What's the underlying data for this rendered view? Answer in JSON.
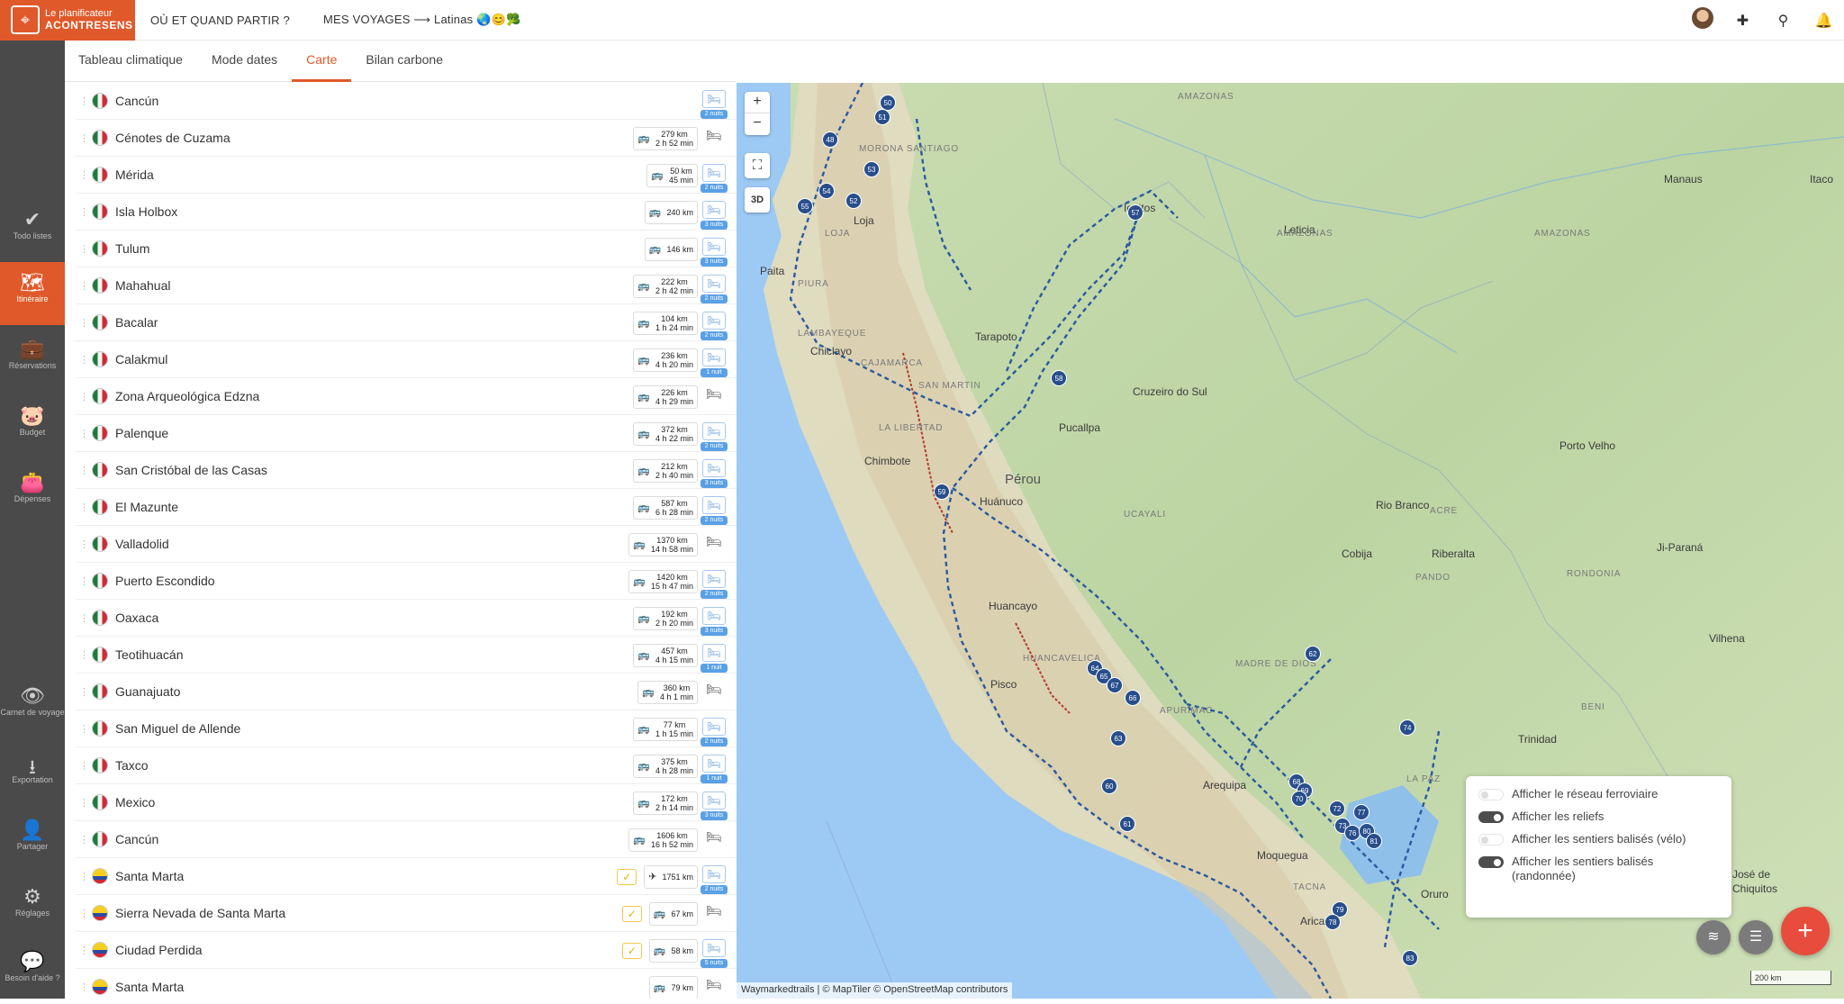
{
  "app": {
    "logo_line1": "Le planificateur",
    "logo_line2": "ACONTRESENS",
    "nav_where": "OÙ ET QUAND PARTIR ?",
    "nav_trips": "MES VOYAGES ⟶ Latinas 🌏😊🥦"
  },
  "sidebar": {
    "items": [
      {
        "label": "Todo listes",
        "icon": "check-icon"
      },
      {
        "label": "Itinéraire",
        "icon": "map-icon"
      },
      {
        "label": "Réservations",
        "icon": "suitcase-icon"
      },
      {
        "label": "Budget",
        "icon": "piggy-bank-icon"
      },
      {
        "label": "Dépenses",
        "icon": "wallet-icon"
      },
      {
        "label": "Carnet de voyage",
        "icon": "eye-icon"
      },
      {
        "label": "Exportation",
        "icon": "download-icon"
      },
      {
        "label": "Partager",
        "icon": "add-user-icon"
      },
      {
        "label": "Réglages",
        "icon": "gear-icon"
      },
      {
        "label": "Besoin d'aide ?",
        "icon": "chat-icon"
      }
    ]
  },
  "tabs": [
    "Tableau climatique",
    "Mode dates",
    "Carte",
    "Bilan carbone"
  ],
  "active_tab": "Carte",
  "itinerary": [
    {
      "name": "Cancún",
      "flag": "mx",
      "dist": "",
      "time": "",
      "nights": "2 nuits",
      "num": "1",
      "color": "yellow",
      "mode": ""
    },
    {
      "name": "Cénotes de Cuzama",
      "flag": "mx",
      "dist": "279 km",
      "time": "2 h 52 min",
      "nights": "",
      "num": "2",
      "color": "green",
      "mode": "bus"
    },
    {
      "name": "Mérida",
      "flag": "mx",
      "dist": "50 km",
      "time": "45 min",
      "nights": "2 nuits",
      "num": "3",
      "color": "green",
      "mode": "bus"
    },
    {
      "name": "Isla Holbox",
      "flag": "mx",
      "dist": "240 km",
      "time": "",
      "nights": "3 nuits",
      "num": "4",
      "color": "green",
      "mode": "bus"
    },
    {
      "name": "Tulum",
      "flag": "mx",
      "dist": "146 km",
      "time": "",
      "nights": "3 nuits",
      "num": "5",
      "color": "green",
      "mode": "bus"
    },
    {
      "name": "Mahahual",
      "flag": "mx",
      "dist": "222 km",
      "time": "2 h 42 min",
      "nights": "2 nuits",
      "num": "6",
      "color": "green",
      "mode": "bus"
    },
    {
      "name": "Bacalar",
      "flag": "mx",
      "dist": "104 km",
      "time": "1 h 24 min",
      "nights": "2 nuits",
      "num": "7",
      "color": "green",
      "mode": "bus"
    },
    {
      "name": "Calakmul",
      "flag": "mx",
      "dist": "236 km",
      "time": "4 h 20 min",
      "nights": "1 nuit",
      "num": "8",
      "color": "green",
      "mode": "bus"
    },
    {
      "name": "Zona Arqueológica Edzna",
      "flag": "mx",
      "dist": "226 km",
      "time": "4 h 29 min",
      "nights": "",
      "num": "9",
      "color": "green",
      "mode": "bus"
    },
    {
      "name": "Palenque",
      "flag": "mx",
      "dist": "372 km",
      "time": "4 h 22 min",
      "nights": "2 nuits",
      "num": "10",
      "color": "green",
      "mode": "bus"
    },
    {
      "name": "San Cristóbal de las Casas",
      "flag": "mx",
      "dist": "212 km",
      "time": "2 h 40 min",
      "nights": "3 nuits",
      "num": "11",
      "color": "yellow",
      "mode": "bus"
    },
    {
      "name": "El Mazunte",
      "flag": "mx",
      "dist": "587 km",
      "time": "6 h 28 min",
      "nights": "2 nuits",
      "num": "12",
      "color": "green",
      "mode": "bus"
    },
    {
      "name": "Valladolid",
      "flag": "mx",
      "dist": "1370 km",
      "time": "14 h 58 min",
      "nights": "",
      "num": "13",
      "color": "green",
      "mode": "bus"
    },
    {
      "name": "Puerto Escondido",
      "flag": "mx",
      "dist": "1420 km",
      "time": "15 h 47 min",
      "nights": "2 nuits",
      "num": "14",
      "color": "green",
      "mode": "bus"
    },
    {
      "name": "Oaxaca",
      "flag": "mx",
      "dist": "192 km",
      "time": "2 h 20 min",
      "nights": "3 nuits",
      "num": "15",
      "color": "green",
      "mode": "bus"
    },
    {
      "name": "Teotihuacán",
      "flag": "mx",
      "dist": "457 km",
      "time": "4 h 15 min",
      "nights": "1 nuit",
      "num": "16",
      "color": "red",
      "mode": "bus"
    },
    {
      "name": "Guanajuato",
      "flag": "mx",
      "dist": "360 km",
      "time": "4 h 1 min",
      "nights": "",
      "num": "17",
      "color": "orange",
      "mode": "bus"
    },
    {
      "name": "San Miguel de Allende",
      "flag": "mx",
      "dist": "77 km",
      "time": "1 h 15 min",
      "nights": "2 nuits",
      "num": "18",
      "color": "orange",
      "mode": "bus"
    },
    {
      "name": "Taxco",
      "flag": "mx",
      "dist": "375 km",
      "time": "4 h 28 min",
      "nights": "1 nuit",
      "num": "19",
      "color": "green",
      "mode": "bus"
    },
    {
      "name": "Mexico",
      "flag": "mx",
      "dist": "172 km",
      "time": "2 h 14 min",
      "nights": "3 nuits",
      "num": "20",
      "color": "yellow",
      "mode": "bus"
    },
    {
      "name": "Cancún",
      "flag": "mx",
      "dist": "1606 km",
      "time": "16 h 52 min",
      "nights": "",
      "num": "21",
      "color": "yellow",
      "mode": "bus"
    },
    {
      "name": "Santa Marta",
      "flag": "co",
      "dist": "1751 km",
      "time": "",
      "nights": "2 nuits",
      "num": "22",
      "color": "green",
      "mode": "plane",
      "check": true
    },
    {
      "name": "Sierra Nevada de Santa Marta",
      "flag": "co",
      "dist": "67 km",
      "time": "",
      "nights": "",
      "num": "23",
      "color": "green",
      "mode": "bus",
      "check": true
    },
    {
      "name": "Ciudad Perdida",
      "flag": "co",
      "dist": "58 km",
      "time": "",
      "nights": "5 nuits",
      "num": "24",
      "color": "green",
      "mode": "bus",
      "check": true
    },
    {
      "name": "Santa Marta",
      "flag": "co",
      "dist": "79 km",
      "time": "",
      "nights": "",
      "num": "25",
      "color": "yellow",
      "mode": "bus"
    }
  ],
  "map": {
    "labels": [
      {
        "text": "Manaus",
        "cls": ""
      },
      {
        "text": "Itaco",
        "cls": ""
      },
      {
        "text": "AMAZONAS",
        "cls": "small"
      },
      {
        "text": "AMAZONAS",
        "cls": "small"
      },
      {
        "text": "Leticia",
        "cls": ""
      },
      {
        "text": "Iquitos",
        "cls": ""
      },
      {
        "text": "Paita",
        "cls": ""
      },
      {
        "text": "Loja",
        "cls": ""
      },
      {
        "text": "Chiclayo",
        "cls": ""
      },
      {
        "text": "Tarapoto",
        "cls": ""
      },
      {
        "text": "Cruzeiro do Sul",
        "cls": ""
      },
      {
        "text": "Pucallpa",
        "cls": ""
      },
      {
        "text": "Chimbote",
        "cls": ""
      },
      {
        "text": "Pérou",
        "cls": "country"
      },
      {
        "text": "Huánuco",
        "cls": ""
      },
      {
        "text": "Porto Velho",
        "cls": ""
      },
      {
        "text": "Rio Branco",
        "cls": ""
      },
      {
        "text": "Cobija",
        "cls": ""
      },
      {
        "text": "Riberalta",
        "cls": ""
      },
      {
        "text": "Ji-Paraná",
        "cls": ""
      },
      {
        "text": "Huancayo",
        "cls": ""
      },
      {
        "text": "Pisco",
        "cls": ""
      },
      {
        "text": "Vilhena",
        "cls": ""
      },
      {
        "text": "Trinidad",
        "cls": ""
      },
      {
        "text": "Arequipa",
        "cls": ""
      },
      {
        "text": "Moquegua",
        "cls": ""
      },
      {
        "text": "Arica",
        "cls": ""
      },
      {
        "text": "Oruro",
        "cls": ""
      },
      {
        "text": "José de",
        "cls": ""
      },
      {
        "text": "Chiquitos",
        "cls": ""
      },
      {
        "text": "AMAZONAS",
        "cls": "small"
      },
      {
        "text": "MORONA SANTIAGO",
        "cls": "small"
      },
      {
        "text": "LAMBAYEQUE",
        "cls": "small"
      },
      {
        "text": "CAJAMARCA",
        "cls": "small"
      },
      {
        "text": "SAN MARTIN",
        "cls": "small"
      },
      {
        "text": "LA LIBERTAD",
        "cls": "small"
      },
      {
        "text": "UCAYALI",
        "cls": "small"
      },
      {
        "text": "HUANCAVELICA",
        "cls": "small"
      },
      {
        "text": "APURIMAC",
        "cls": "small"
      },
      {
        "text": "MADRE DE DIOS",
        "cls": "small"
      },
      {
        "text": "PANDO",
        "cls": "small"
      },
      {
        "text": "RONDONIA",
        "cls": "small"
      },
      {
        "text": "BENI",
        "cls": "small"
      },
      {
        "text": "LA PAZ",
        "cls": "small"
      },
      {
        "text": "TACNA",
        "cls": "small"
      },
      {
        "text": "PIURA",
        "cls": "small"
      },
      {
        "text": "LOJA",
        "cls": "small"
      },
      {
        "text": "ACRE",
        "cls": "small"
      }
    ],
    "markers": [
      "50",
      "51",
      "48",
      "53",
      "54",
      "55",
      "52",
      "57",
      "58",
      "59",
      "62",
      "64",
      "65",
      "67",
      "66",
      "63",
      "60",
      "61",
      "68",
      "69",
      "70",
      "72",
      "73",
      "77",
      "76",
      "80",
      "81",
      "74",
      "79",
      "78",
      "83"
    ],
    "layer_options": [
      {
        "label": "Afficher le réseau ferroviaire",
        "on": false
      },
      {
        "label": "Afficher les reliefs",
        "on": true
      },
      {
        "label": "Afficher les sentiers balisés (vélo)",
        "on": false
      },
      {
        "label": "Afficher les sentiers balisés (randonnée)",
        "on": true
      }
    ],
    "attribution": "Waymarkedtrails | © MapTiler © OpenStreetMap contributors",
    "scale": "200 km",
    "zoom_in": "+",
    "zoom_out": "−",
    "view_3d": "3D"
  }
}
